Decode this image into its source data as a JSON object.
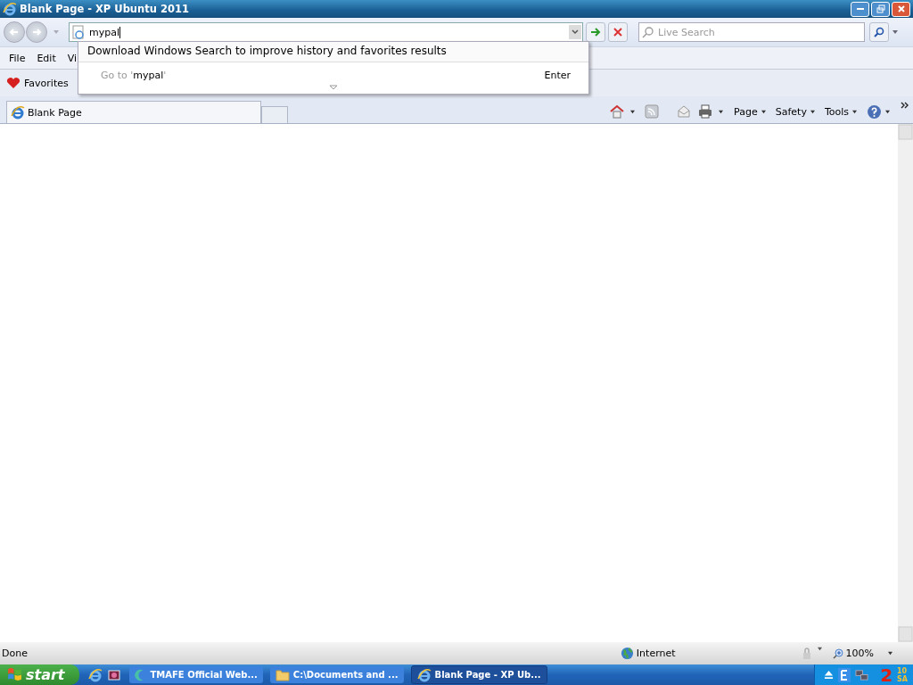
{
  "window": {
    "title": "Blank Page - XP Ubuntu 2011"
  },
  "address_bar": {
    "value": "mypal"
  },
  "search": {
    "placeholder": "Live Search"
  },
  "menu": [
    "File",
    "Edit",
    "Vi"
  ],
  "favorites": {
    "label": "Favorites"
  },
  "tabs": [
    {
      "label": "Blank Page",
      "selected": true
    }
  ],
  "command_bar": [
    "Page",
    "Safety",
    "Tools"
  ],
  "dropdown": {
    "message": "Download Windows Search to improve history and favorites results",
    "goto_prefix": "Go to '",
    "goto_query": "mypal",
    "goto_suffix": "'",
    "hint": "Enter"
  },
  "status_bar": {
    "text": "Done",
    "zone": "Internet",
    "zoom": "100%"
  },
  "taskbar": {
    "start": "start",
    "buttons": [
      {
        "label": "TMAFE Official Web...",
        "selected": false,
        "kind": "app"
      },
      {
        "label": "C:\\Documents and ...",
        "selected": false,
        "kind": "folder"
      },
      {
        "label": "Blank Page - XP Ub...",
        "selected": true,
        "kind": "ie"
      }
    ],
    "clock": {
      "hour": "2",
      "minute": "10",
      "period": "SA"
    }
  }
}
